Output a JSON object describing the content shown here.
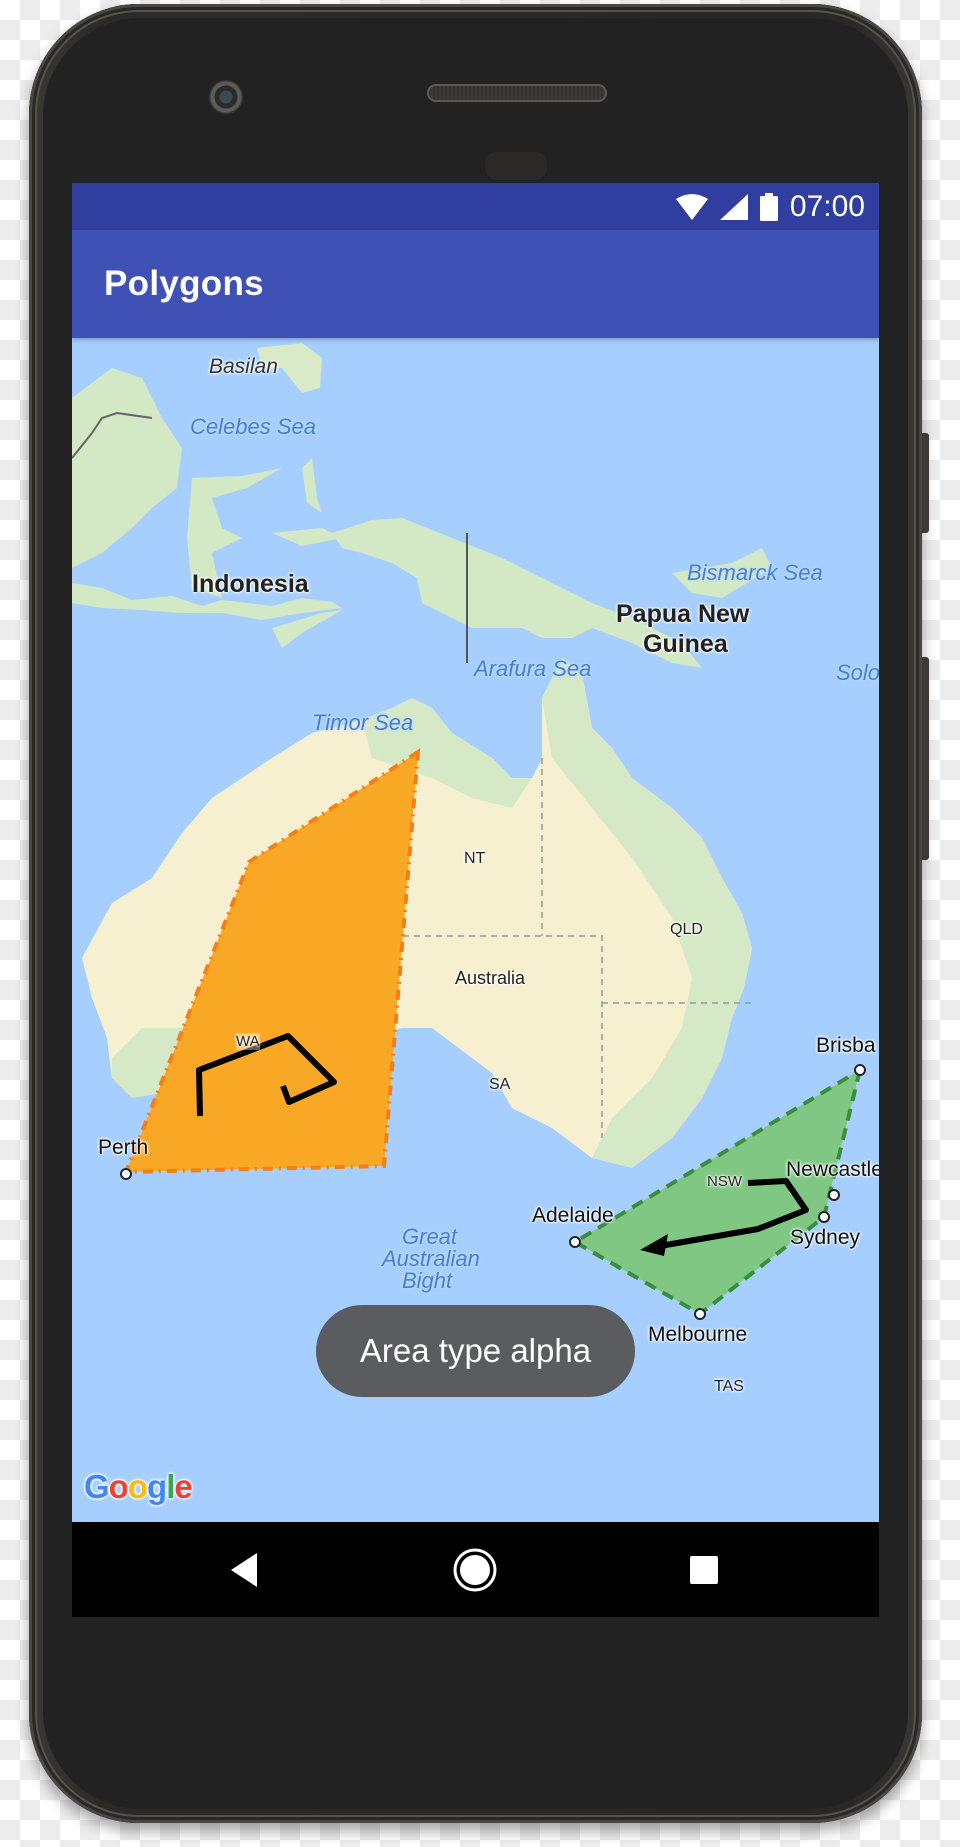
{
  "status_bar": {
    "time": "07:00",
    "icons": [
      "wifi-icon",
      "cell-signal-icon",
      "battery-icon"
    ]
  },
  "app_bar": {
    "title": "Polygons"
  },
  "map": {
    "labels": {
      "basilan": "Basilan",
      "celebes_sea": "Celebes Sea",
      "indonesia": "Indonesia",
      "bismarck_sea": "Bismarck Sea",
      "png_line1": "Papua New",
      "png_line2": "Guinea",
      "arafura_sea": "Arafura Sea",
      "solomon_partial": "Solo",
      "timor_sea": "Timor Sea",
      "nt": "NT",
      "qld": "QLD",
      "australia": "Australia",
      "wa": "WA",
      "sa": "SA",
      "nsw": "NSW",
      "perth": "Perth",
      "brisbane_partial": "Brisba",
      "newcastle": "Newcastle",
      "sydney": "Sydney",
      "adelaide": "Adelaide",
      "melbourne": "Melbourne",
      "tas": "TAS",
      "gab_line1": "Great",
      "gab_line2": "Australian",
      "gab_line3": "Bight"
    },
    "polygons": [
      {
        "name": "western-australia-area",
        "fill": "#F9A825",
        "stroke": "#F57F17",
        "stroke_style": "dash-dot"
      },
      {
        "name": "south-east-area",
        "fill": "#81C784",
        "stroke": "#388E3C",
        "stroke_style": "dashed"
      }
    ],
    "polyline_color": "#000000",
    "colors": {
      "water": "#A6CFFF",
      "land": "#F5F0D0",
      "vegetation": "#D6E9C6",
      "sea_label": "#4A7FCF"
    },
    "attribution": "Google"
  },
  "toast": {
    "message": "Area type alpha"
  },
  "nav_bar": {
    "buttons": [
      "back",
      "home",
      "recents"
    ]
  },
  "theme": {
    "primary": "#3F51B5",
    "primary_dark": "#303F9F"
  }
}
